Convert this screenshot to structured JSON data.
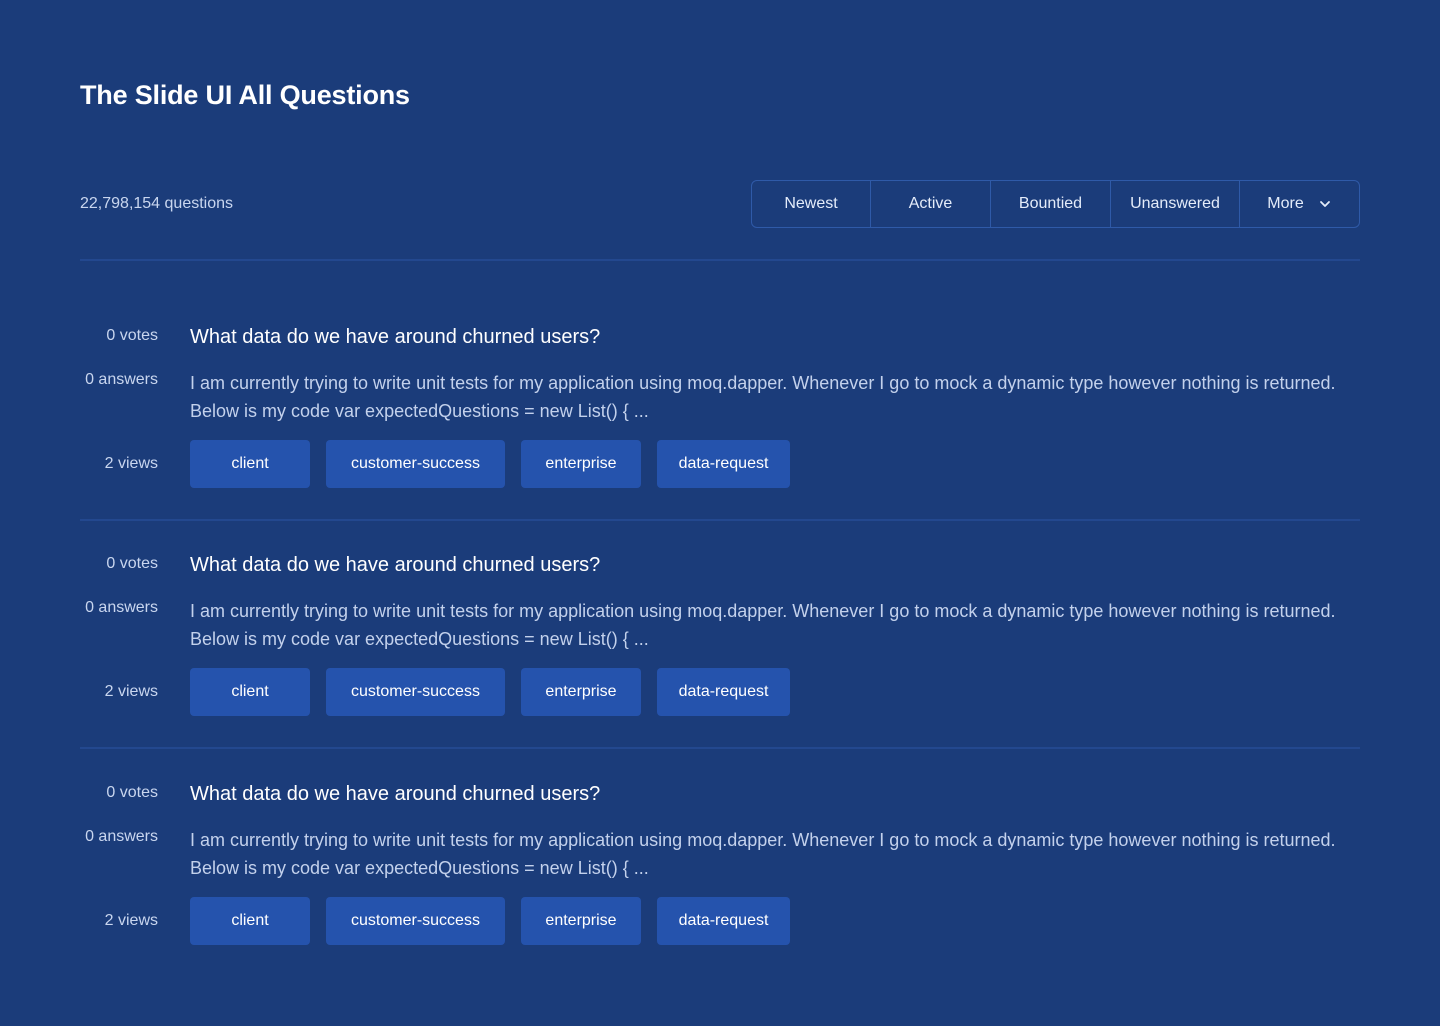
{
  "header": {
    "title": "The Slide UI All Questions"
  },
  "toolbar": {
    "count": "22,798,154 questions",
    "tabs": [
      "Newest",
      "Active",
      "Bountied",
      "Unanswered",
      "More"
    ],
    "more_icon": "chevron-down-icon"
  },
  "questions": [
    {
      "votes": "0 votes",
      "answers": "0 answers",
      "views": "2 views",
      "title": "What data do we have around churned users?",
      "excerpt": "I am currently trying to write unit tests for my application using moq.dapper. Whenever I go to mock a dynamic type however nothing is returned. Below is my code var expectedQuestions = new List() { ...",
      "tags": [
        "client",
        "customer-success",
        "enterprise",
        "data-request"
      ]
    },
    {
      "votes": "0 votes",
      "answers": "0 answers",
      "views": "2 views",
      "title": "What data do we have around churned users?",
      "excerpt": "I am currently trying to write unit tests for my application using moq.dapper. Whenever I go to mock a dynamic type however nothing is returned. Below is my code var expectedQuestions = new List() { ...",
      "tags": [
        "client",
        "customer-success",
        "enterprise",
        "data-request"
      ]
    },
    {
      "votes": "0 votes",
      "answers": "0 answers",
      "views": "2 views",
      "title": "What data do we have around churned users?",
      "excerpt": "I am currently trying to write unit tests for my application using moq.dapper. Whenever I go to mock a dynamic type however nothing is returned. Below is my code var expectedQuestions = new List() { ...",
      "tags": [
        "client",
        "customer-success",
        "enterprise",
        "data-request"
      ]
    }
  ],
  "colors": {
    "background": "#1b3c7a",
    "tag": "#2553ad",
    "border": "#2f5aa8"
  }
}
